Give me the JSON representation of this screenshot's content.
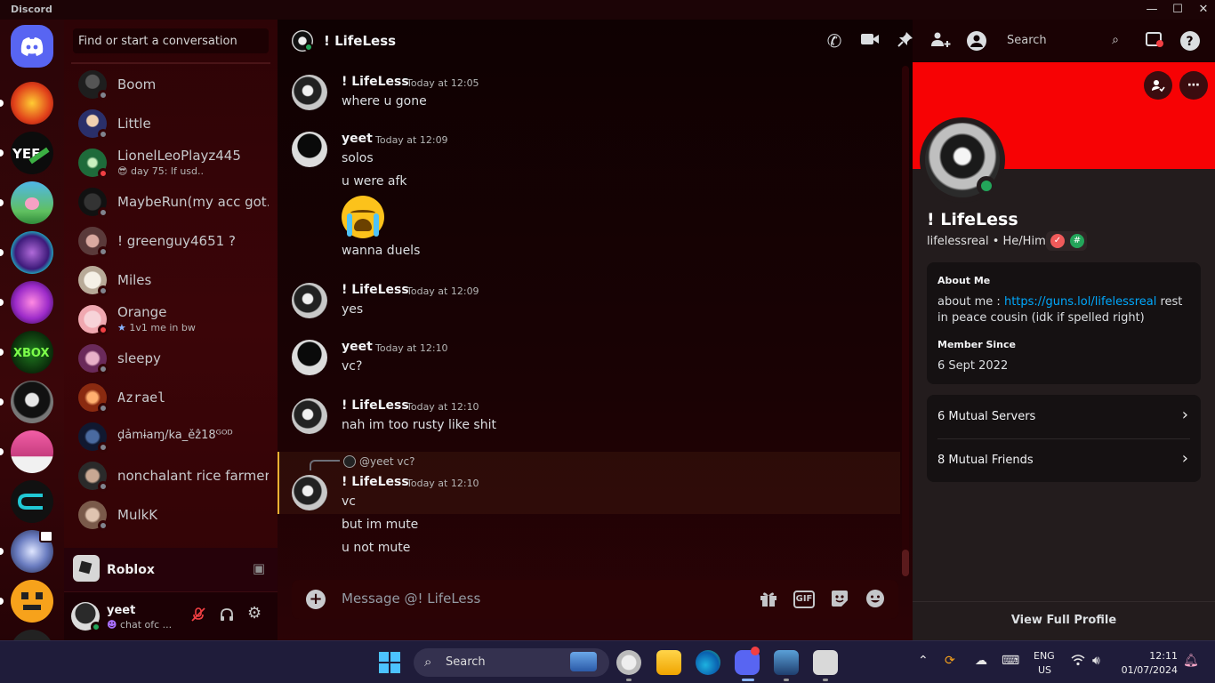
{
  "app": {
    "title": "Discord",
    "controls": {
      "minimize": "—",
      "maximize": "☐",
      "close": "✕"
    }
  },
  "sidebar": {
    "search_placeholder": "Find or start a conversation",
    "dms": [
      {
        "name": "Boom",
        "status": "offline"
      },
      {
        "name": "Little",
        "status": "offline"
      },
      {
        "name": "LionelLeoPlayz445",
        "sub": "day 75: lf usd..",
        "sub_icon": "😎",
        "status": "dnd"
      },
      {
        "name": "MaybeRun(my acc got...",
        "status": "offline"
      },
      {
        "name": "! greenguy4651 ?",
        "status": "offline"
      },
      {
        "name": "Miles",
        "status": "offline"
      },
      {
        "name": "Orange",
        "sub": "1v1 me in bw",
        "sub_icon": "★",
        "status": "dnd"
      },
      {
        "name": "sleepy",
        "status": "offline"
      },
      {
        "name": "Azrael",
        "status": "offline"
      },
      {
        "name": "ḑảmɨaɱ/ka_ěẑ18ᴳᴼᴰ",
        "status": "offline"
      },
      {
        "name": "nonchalant rice farmer",
        "status": "offline"
      },
      {
        "name": "MulkK",
        "status": "offline"
      }
    ],
    "activity": {
      "name": "Roblox"
    },
    "user": {
      "name": "yeet",
      "status": "chat ofc ...",
      "status_icon": "☻"
    }
  },
  "chat": {
    "recipient": "! LifeLess",
    "header_search": "Search",
    "messages": [
      {
        "author": "! LifeLess",
        "time": "Today at 12:05",
        "lines": [
          "where u gone"
        ]
      },
      {
        "author": "yeet",
        "time": "Today at 12:09",
        "lines": [
          "solos",
          "u were afk",
          "wanna duels"
        ],
        "emoji": "loudly-crying-face"
      },
      {
        "author": "! LifeLess",
        "time": "Today at 12:09",
        "lines": [
          "yes"
        ]
      },
      {
        "author": "yeet",
        "time": "Today at 12:10",
        "lines": [
          "vc?"
        ]
      },
      {
        "author": "! LifeLess",
        "time": "Today at 12:10",
        "lines": [
          "nah im too rusty like shit"
        ]
      },
      {
        "author": "! LifeLess",
        "time": "Today at 12:10",
        "reply_to": "@yeet vc?",
        "lines": [
          "vc",
          "but im mute",
          "u not mute"
        ]
      }
    ],
    "composer_placeholder": "Message @! LifeLess",
    "gif_label": "GIF"
  },
  "profile": {
    "display_name": "! LifeLess",
    "username": "lifelessreal",
    "pronouns": "He/Him",
    "about_heading": "About Me",
    "about_prefix": "about me : ",
    "about_link": "https://guns.lol/lifelessreal",
    "about_suffix": " rest in peace cousin (idk if spelled right)",
    "member_heading": "Member Since",
    "member_since": "6 Sept 2022",
    "mutual_servers": "6 Mutual Servers",
    "mutual_friends": "8 Mutual Friends",
    "view_full": "View Full Profile",
    "banner_color": "#f70204"
  },
  "taskbar": {
    "search": "Search",
    "lang_top": "ENG",
    "lang_bottom": "US",
    "time": "12:11",
    "date": "01/07/2024"
  }
}
